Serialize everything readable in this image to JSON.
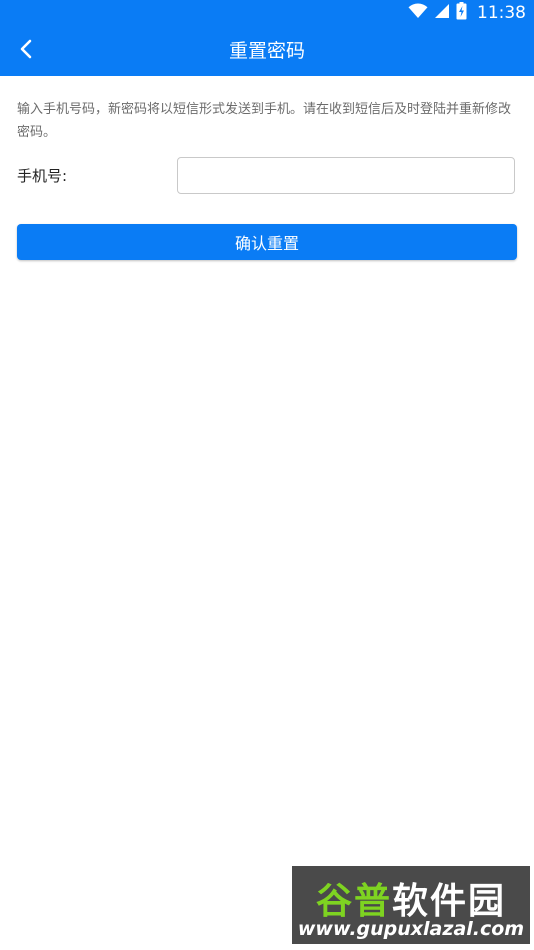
{
  "status_bar": {
    "time": "11:38",
    "icons": [
      "wifi-icon",
      "cellular-signal-icon",
      "battery-charging-icon"
    ]
  },
  "app_bar": {
    "title": "重置密码",
    "back_icon": "chevron-left-icon"
  },
  "form": {
    "notice": "输入手机号码，新密码将以短信形式发送到手机。请在收到短信后及时登陆并重新修改密码。",
    "phone_label": "手机号:",
    "phone_value": "",
    "phone_placeholder": "",
    "submit_label": "确认重置"
  },
  "watermark": {
    "title_part1": "谷普",
    "title_part2": "软件园",
    "url": "www.gupuxlazal.com"
  },
  "colors": {
    "primary": "#0a7cf5",
    "background": "#ffffff",
    "notice_text": "#6b6b6b",
    "input_border": "#c9c9c9"
  }
}
